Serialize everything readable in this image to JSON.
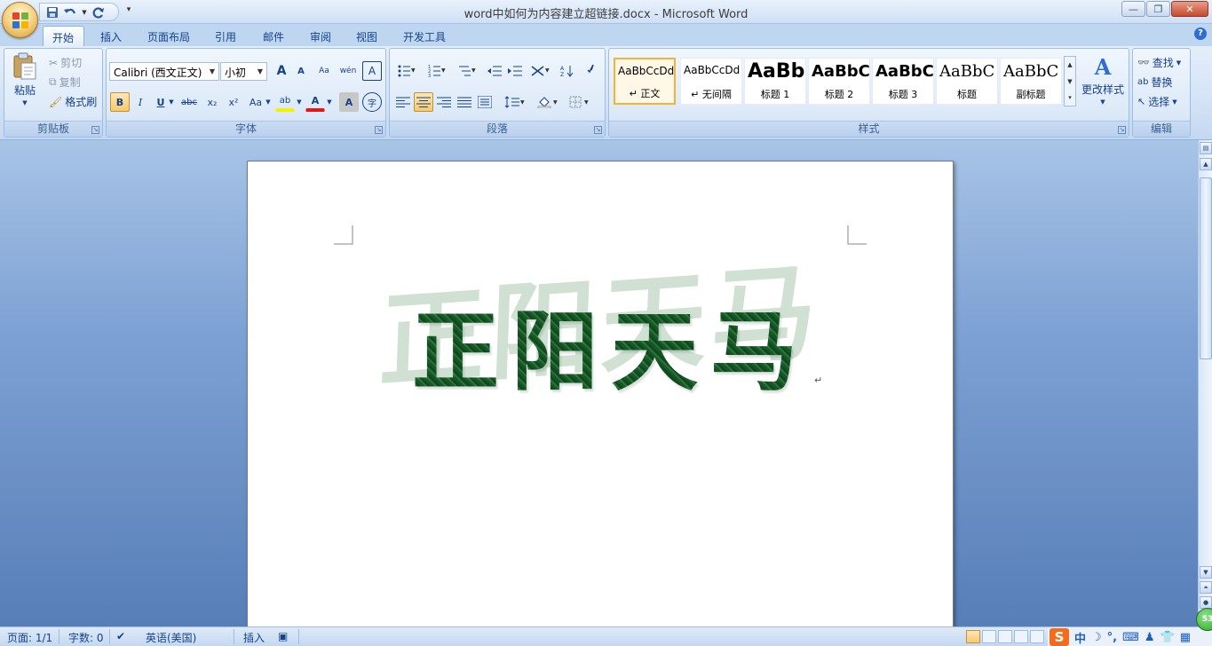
{
  "window": {
    "title": "word中如何为内容建立超链接.docx - Microsoft Word",
    "controls": {
      "minimize": "—",
      "restore": "❐",
      "close": "✕"
    }
  },
  "tabs": [
    "开始",
    "插入",
    "页面布局",
    "引用",
    "邮件",
    "审阅",
    "视图",
    "开发工具"
  ],
  "active_tab": "开始",
  "ribbon": {
    "clipboard": {
      "label": "剪贴板",
      "paste": "粘贴",
      "cut": "剪切",
      "copy": "复制",
      "format_painter": "格式刷"
    },
    "font": {
      "label": "字体",
      "font_name": "Calibri (西文正文)",
      "font_size": "小初",
      "grow": "A",
      "shrink": "A",
      "clear_format": "Aa",
      "phonetic": "wén",
      "char_border": "A",
      "bold": "B",
      "italic": "I",
      "underline": "U",
      "strike": "abc",
      "subscript": "x₂",
      "superscript": "x²",
      "change_case": "Aa",
      "highlight": "ab",
      "font_color": "A",
      "char_shading": "A",
      "enclose": "字"
    },
    "paragraph": {
      "label": "段落"
    },
    "styles": {
      "label": "样式",
      "items": [
        {
          "sample": "AaBbCcDd",
          "name": "↵ 正文"
        },
        {
          "sample": "AaBbCcDd",
          "name": "↵ 无间隔"
        },
        {
          "sample": "AaBb",
          "name": "标题 1"
        },
        {
          "sample": "AaBbC",
          "name": "标题 2"
        },
        {
          "sample": "AaBbC",
          "name": "标题 3"
        },
        {
          "sample": "AaBbC",
          "name": "标题"
        },
        {
          "sample": "AaBbC",
          "name": "副标题"
        }
      ],
      "change_styles": "更改样式"
    },
    "editing": {
      "label": "编辑",
      "find": "查找",
      "replace": "替换",
      "select": "选择"
    }
  },
  "document": {
    "wordart_text": "正阳天马",
    "paragraph_mark": "↵"
  },
  "statusbar": {
    "page": "页面: 1/1",
    "words": "字数: 0",
    "language": "英语(美国)",
    "mode": "插入",
    "zoom_badge": "53"
  },
  "ime": {
    "logo": "S",
    "mode": "中"
  },
  "colors": {
    "wordart_green": "#1f6a33",
    "ribbon_blue": "#dce9f8",
    "accent_selection": "#f8c96a",
    "document_background": "#7da1d3"
  }
}
